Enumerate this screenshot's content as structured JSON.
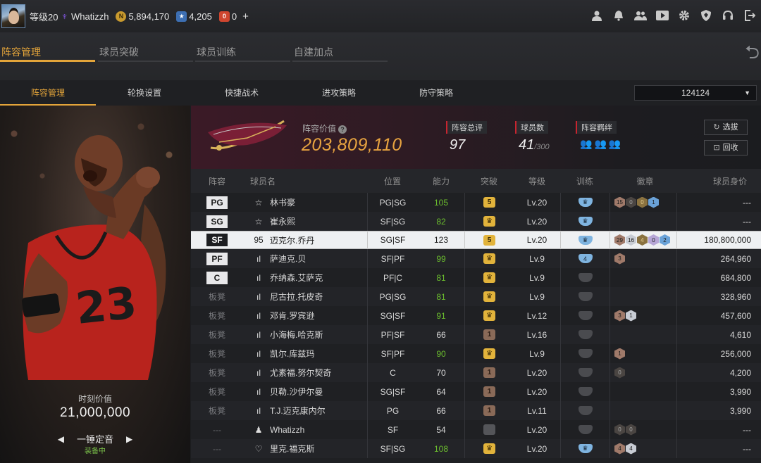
{
  "topbar": {
    "level": "等级20",
    "username": "Whatizzh",
    "coins": "5,894,170",
    "points": "4,205",
    "tickets": "0",
    "coin_glyph": "N",
    "point_glyph": "★",
    "ticket_glyph": "0",
    "plus": "+",
    "icons": [
      "user-icon",
      "bell-icon",
      "friends-icon",
      "video-icon",
      "gear-icon",
      "shield-icon",
      "headset-icon",
      "logout-icon"
    ]
  },
  "main_tabs": [
    "阵容管理",
    "球员突破",
    "球员训练",
    "自建加点"
  ],
  "sub_tabs": [
    "阵容管理",
    "轮换设置",
    "快捷战术",
    "进攻策略",
    "防守策略"
  ],
  "lineup_name": "124124",
  "player_card": {
    "moment_label": "时刻价值",
    "moment_value": "21,000,000",
    "name": "一锤定音",
    "status": "装备中"
  },
  "team": {
    "lineup_value_label": "阵容价值",
    "lineup_value": "203,809,110",
    "total_rating_label": "阵容总评",
    "total_rating": "97",
    "player_count_label": "球员数",
    "player_count": "41",
    "player_count_max": "/300",
    "bonds_label": "阵容羁绊",
    "select_btn": "选拔",
    "recycle_btn": "回收"
  },
  "columns": [
    "阵容",
    "球员名",
    "位置",
    "能力",
    "突破",
    "等级",
    "训练",
    "徽章",
    "球员身价"
  ],
  "rows": [
    {
      "slot": "PG",
      "name": "林书豪",
      "icon": "☆",
      "pos": "PG|SG",
      "ovr": "105",
      "green": true,
      "brk": "5",
      "brk_type": "gold",
      "lv": "Lv.20",
      "train": "tb-blue",
      "train_txt": "♛",
      "badges": [
        [
          "15",
          "bronze"
        ],
        [
          "0",
          "dark"
        ],
        [
          "0",
          "gold"
        ],
        [
          "1",
          "blue"
        ]
      ],
      "value": "---"
    },
    {
      "slot": "SG",
      "name": "崔永熙",
      "icon": "☆",
      "pos": "SF|SG",
      "ovr": "82",
      "green": true,
      "brk": "♛",
      "brk_type": "gold",
      "lv": "Lv.20",
      "train": "tb-blue",
      "train_txt": "♛",
      "badges": [],
      "value": "---"
    },
    {
      "slot": "SF",
      "name": "迈克尔.乔丹",
      "icon": "95",
      "pos": "SG|SF",
      "ovr": "123",
      "green": false,
      "brk": "5",
      "brk_type": "gold",
      "lv": "Lv.20",
      "train": "tb-blue",
      "train_txt": "♛",
      "badges": [
        [
          "29",
          "bronze"
        ],
        [
          "16",
          "silver"
        ],
        [
          "4",
          "gold"
        ],
        [
          "0",
          "purple"
        ],
        [
          "2",
          "blue"
        ]
      ],
      "value": "180,800,000"
    },
    {
      "slot": "PF",
      "name": "萨迪克.贝",
      "icon": "ıl",
      "pos": "SF|PF",
      "ovr": "99",
      "green": true,
      "brk": "♛",
      "brk_type": "gold",
      "lv": "Lv.9",
      "train": "tb-blue",
      "train_txt": "4",
      "badges": [
        [
          "3",
          "bronze"
        ]
      ],
      "value": "264,960"
    },
    {
      "slot": "C",
      "name": "乔纳森.艾萨克",
      "icon": "ıl",
      "pos": "PF|C",
      "ovr": "81",
      "green": true,
      "brk": "♛",
      "brk_type": "gold",
      "lv": "Lv.9",
      "train": "tb-gray",
      "train_txt": "",
      "badges": [],
      "value": "684,800"
    },
    {
      "slot": "板凳",
      "name": "尼古拉.托皮奇",
      "icon": "ıl",
      "pos": "PG|SG",
      "ovr": "81",
      "green": true,
      "brk": "♛",
      "brk_type": "gold",
      "lv": "Lv.9",
      "train": "tb-gray",
      "train_txt": "",
      "badges": [],
      "value": "328,960"
    },
    {
      "slot": "板凳",
      "name": "邓肯.罗宾逊",
      "icon": "ıl",
      "pos": "SG|SF",
      "ovr": "91",
      "green": true,
      "brk": "♛",
      "brk_type": "gold",
      "lv": "Lv.12",
      "train": "tb-gray",
      "train_txt": "",
      "badges": [
        [
          "3",
          "bronze"
        ],
        [
          "1",
          "silver"
        ]
      ],
      "value": "457,600"
    },
    {
      "slot": "板凳",
      "name": "小海梅.哈克斯",
      "icon": "ıl",
      "pos": "PF|SF",
      "ovr": "66",
      "green": false,
      "brk": "1",
      "brk_type": "brown",
      "lv": "Lv.16",
      "train": "tb-gray",
      "train_txt": "",
      "badges": [],
      "value": "4,610"
    },
    {
      "slot": "板凳",
      "name": "凯尔.库兹玛",
      "icon": "ıl",
      "pos": "SF|PF",
      "ovr": "90",
      "green": true,
      "brk": "♛",
      "brk_type": "gold",
      "lv": "Lv.9",
      "train": "tb-gray",
      "train_txt": "",
      "badges": [
        [
          "1",
          "bronze"
        ]
      ],
      "value": "256,000"
    },
    {
      "slot": "板凳",
      "name": "尤素福.努尔契奇",
      "icon": "ıl",
      "pos": "C",
      "ovr": "70",
      "green": false,
      "brk": "1",
      "brk_type": "brown",
      "lv": "Lv.20",
      "train": "tb-gray",
      "train_txt": "",
      "badges": [
        [
          "0",
          "dark"
        ]
      ],
      "value": "4,200"
    },
    {
      "slot": "板凳",
      "name": "贝勒.沙伊尔曼",
      "icon": "ıl",
      "pos": "SG|SF",
      "ovr": "64",
      "green": false,
      "brk": "1",
      "brk_type": "brown",
      "lv": "Lv.20",
      "train": "tb-gray",
      "train_txt": "",
      "badges": [],
      "value": "3,990"
    },
    {
      "slot": "板凳",
      "name": "T.J.迈克康内尔",
      "icon": "ıl",
      "pos": "PG",
      "ovr": "66",
      "green": false,
      "brk": "1",
      "brk_type": "brown",
      "lv": "Lv.11",
      "train": "tb-gray",
      "train_txt": "",
      "badges": [],
      "value": "3,990"
    },
    {
      "slot": "---",
      "name": "Whatizzh",
      "icon": "♟",
      "pos": "SF",
      "ovr": "54",
      "green": false,
      "brk": "",
      "brk_type": "gray",
      "lv": "Lv.20",
      "train": "tb-gray",
      "train_txt": "",
      "badges": [
        [
          "0",
          "dark"
        ],
        [
          "0",
          "dark"
        ]
      ],
      "value": "---"
    },
    {
      "slot": "---",
      "name": "里克.福克斯",
      "icon": "♡",
      "pos": "SF|SG",
      "ovr": "108",
      "green": true,
      "brk": "♛",
      "brk_type": "gold",
      "lv": "Lv.20",
      "train": "tb-blue",
      "train_txt": "♛",
      "badges": [
        [
          "4",
          "bronze"
        ],
        [
          "4",
          "silver"
        ]
      ],
      "value": "---"
    }
  ]
}
